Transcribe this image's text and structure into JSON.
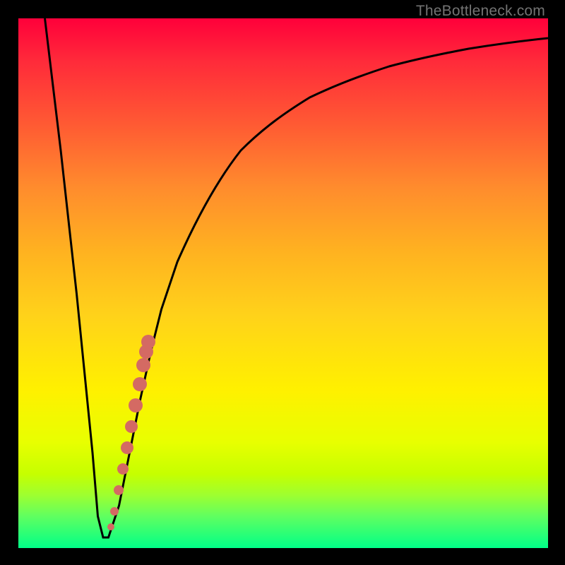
{
  "watermark": "TheBottleneck.com",
  "colors": {
    "frame": "#000000",
    "curve": "#000000",
    "marker": "#d46a63",
    "gradient_top": "#ff003a",
    "gradient_bottom": "#00ff88"
  },
  "chart_data": {
    "type": "line",
    "title": "",
    "xlabel": "",
    "ylabel": "",
    "xlim": [
      0,
      100
    ],
    "ylim": [
      0,
      100
    ],
    "grid": false,
    "series": [
      {
        "name": "bottleneck-curve",
        "x": [
          5,
          8,
          11,
          14,
          15,
          16,
          17,
          19,
          21,
          23,
          25,
          27,
          30,
          34,
          38,
          42,
          46,
          50,
          55,
          60,
          65,
          70,
          75,
          80,
          85,
          90,
          95,
          100
        ],
        "y": [
          100,
          75,
          48,
          18,
          6,
          2,
          2,
          8,
          18,
          28,
          37,
          45,
          54,
          63,
          70,
          75,
          79,
          82,
          85,
          87.5,
          89.5,
          91,
          92.3,
          93.3,
          94.2,
          95,
          95.6,
          96.2
        ]
      }
    ],
    "markers": {
      "name": "highlight-points",
      "color": "#d46a63",
      "x": [
        17.5,
        18.2,
        19.0,
        19.8,
        20.6,
        21.4,
        22.2,
        23.0,
        23.6,
        24.2,
        24.6
      ],
      "y": [
        4,
        7,
        11,
        15,
        19,
        23,
        27,
        31,
        35,
        37,
        39
      ]
    }
  }
}
